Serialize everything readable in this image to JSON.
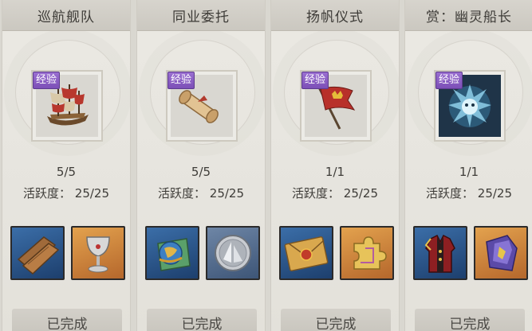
{
  "cards": [
    {
      "title": "巡航舰队",
      "badge": "经验",
      "reward_icon": "galleon-ship-icon",
      "progress": "5/5",
      "activity_label": "活跃度：",
      "activity_value": "25/25",
      "items": [
        "wooden-planks-icon",
        "silver-goblet-icon"
      ],
      "button": "已完成"
    },
    {
      "title": "同业委托",
      "badge": "经验",
      "reward_icon": "scroll-icon",
      "progress": "5/5",
      "activity_label": "活跃度：",
      "activity_value": "25/25",
      "items": [
        "globe-map-icon",
        "silver-sail-coin-icon"
      ],
      "button": "已完成"
    },
    {
      "title": "扬帆仪式",
      "badge": "经验",
      "reward_icon": "crown-flag-icon",
      "progress": "1/1",
      "activity_label": "活跃度：",
      "activity_value": "25/25",
      "items": [
        "sealed-letter-icon",
        "puzzle-piece-icon"
      ],
      "button": "已完成"
    },
    {
      "title": "赏：幽灵船长",
      "badge": "经验",
      "reward_icon": "ghost-captain-icon",
      "progress": "1/1",
      "activity_label": "活跃度：",
      "activity_value": "25/25",
      "items": [
        "captain-coat-icon",
        "purple-fragment-icon"
      ],
      "button": "已完成"
    }
  ],
  "colors": {
    "badge": "#8a5cc6",
    "item_blue": "#2c5688",
    "item_orange": "#cf8a3f"
  }
}
